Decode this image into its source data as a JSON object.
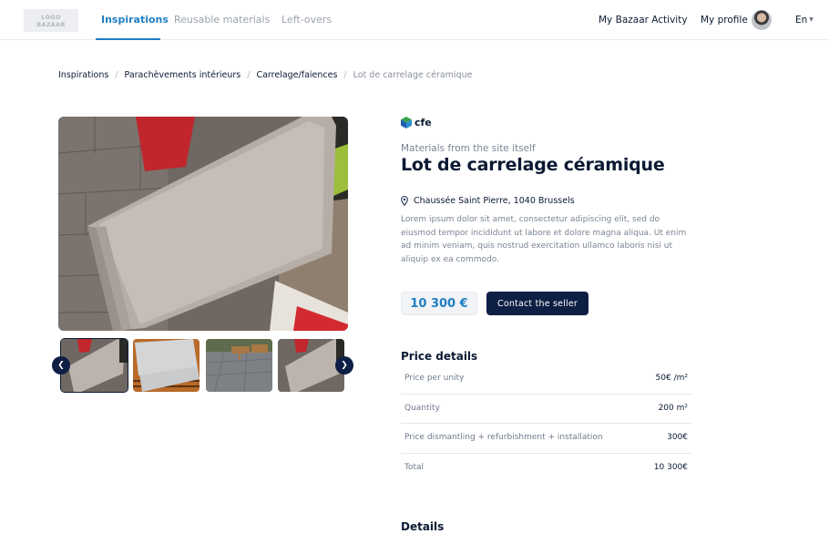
{
  "header": {
    "logo_text": "LOGO\nBAZAAR",
    "tabs": [
      {
        "label": "Inspirations"
      },
      {
        "label": "Reusable materials"
      },
      {
        "label": "Left-overs"
      }
    ],
    "activity_label": "My Bazaar Activity",
    "profile_label": "My profile",
    "language": "En"
  },
  "breadcrumb": [
    "Inspirations",
    "Parachèvements intérieurs",
    "Carrelage/faiences",
    "Lot de carrelage céramique"
  ],
  "product": {
    "brand": "cfe",
    "subtitle": "Materials from the site itself",
    "title": "Lot de carrelage céramique",
    "address": "Chaussée Saint Pierre, 1040 Brussels",
    "description": "Lorem ipsum dolor sit amet, consectetur adipiscing elit, sed do eiusmod tempor incididunt ut labore et dolore magna aliqua. Ut enim ad minim veniam, quis nostrud exercitation ullamco laboris nisi ut aliquip ex ea commodo.",
    "price": "10 300 €",
    "contact_label": "Contact the seller"
  },
  "price_details": {
    "title": "Price details",
    "rows": [
      {
        "label": "Price per unity",
        "value": "50€ /m²"
      },
      {
        "label": "Quantity",
        "value": "200 m²"
      },
      {
        "label": "Price dismantling + refurbishment + installation",
        "value": "300€"
      },
      {
        "label": "Total",
        "value": "10 300€"
      }
    ]
  },
  "details_title": "Details",
  "colors": {
    "accent": "#1f7fc4",
    "navy": "#0e1f45"
  },
  "icons": [
    "location-pin-icon",
    "chevron-left-icon",
    "chevron-right-icon",
    "chevron-down-icon",
    "cfe-logo-icon"
  ]
}
